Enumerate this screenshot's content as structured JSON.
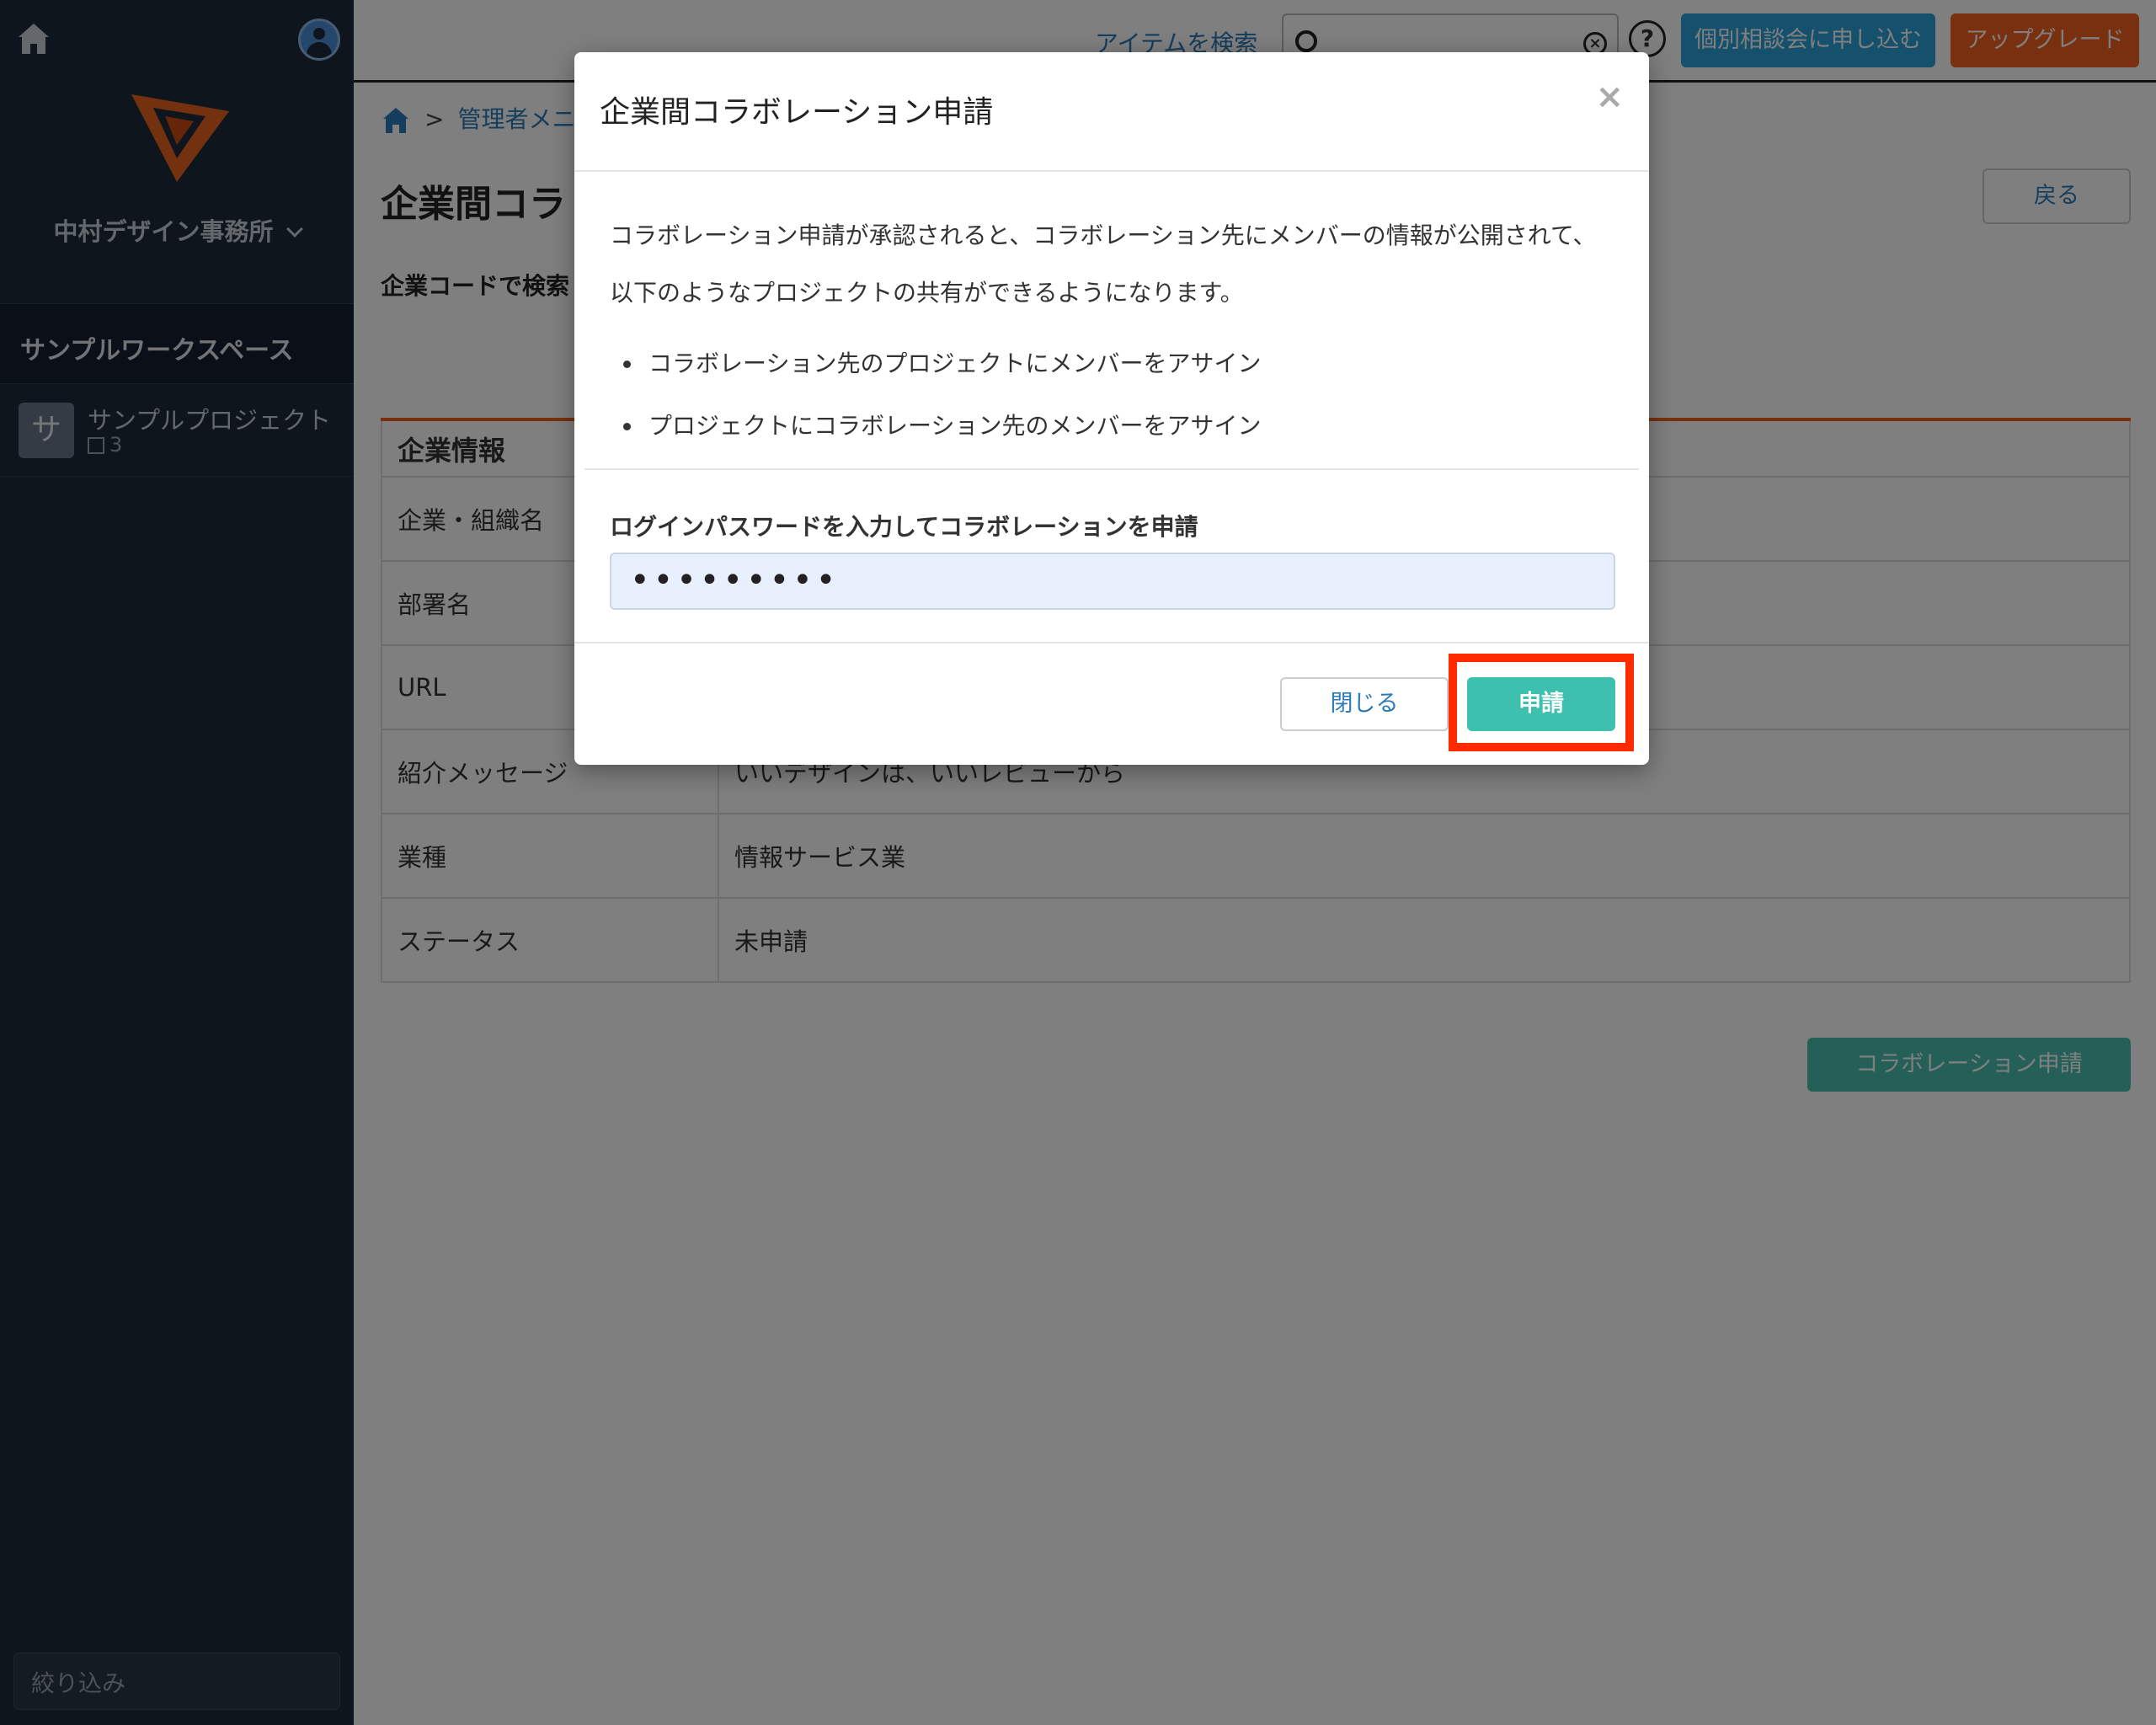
{
  "sidebar": {
    "org_name": "中村デザイン事務所",
    "workspace": "サンプルワークスペース",
    "project": {
      "initial": "サ",
      "name": "サンプルプロジェクト",
      "count": "3"
    },
    "filter_placeholder": "絞り込み"
  },
  "topbar": {
    "search_link": "アイテムを検索",
    "help": "?",
    "consult_button": "個別相談会に申し込む",
    "upgrade_button": "アップグレード"
  },
  "breadcrumb": {
    "separator": ">",
    "item": "管理者メニ"
  },
  "page": {
    "title": "企業間コラ",
    "back_button": "戻る",
    "code_search_label": "企業コードで検索",
    "table_header": "企業情報",
    "rows": [
      {
        "key": "企業・組織名",
        "value": ""
      },
      {
        "key": "部署名",
        "value": ""
      },
      {
        "key": "URL",
        "value": ""
      },
      {
        "key": "紹介メッセージ",
        "value": "いいデザインは、いいレビューから"
      },
      {
        "key": "業種",
        "value": "情報サービス業"
      },
      {
        "key": "ステータス",
        "value": "未申請"
      }
    ],
    "collab_button": "コラボレーション申請"
  },
  "modal": {
    "title": "企業間コラボレーション申請",
    "close": "×",
    "desc1": "コラボレーション申請が承認されると、コラボレーション先にメンバーの情報が公開されて、",
    "desc2": "以下のようなプロジェクトの共有ができるようになります。",
    "bullets": [
      "コラボレーション先のプロジェクトにメンバーをアサイン",
      "プロジェクトにコラボレーション先のメンバーをアサイン"
    ],
    "password_label": "ログインパスワードを入力してコラボレーションを申請",
    "password_value": "•••••••••",
    "close_button": "閉じる",
    "submit_button": "申請"
  },
  "colors": {
    "sidebar_bg": "#1f2a3a",
    "accent_teal": "#3dc0ae",
    "accent_orange": "#f0611e",
    "accent_blue": "#2aa0d8",
    "highlight_red": "#ff2a00"
  }
}
